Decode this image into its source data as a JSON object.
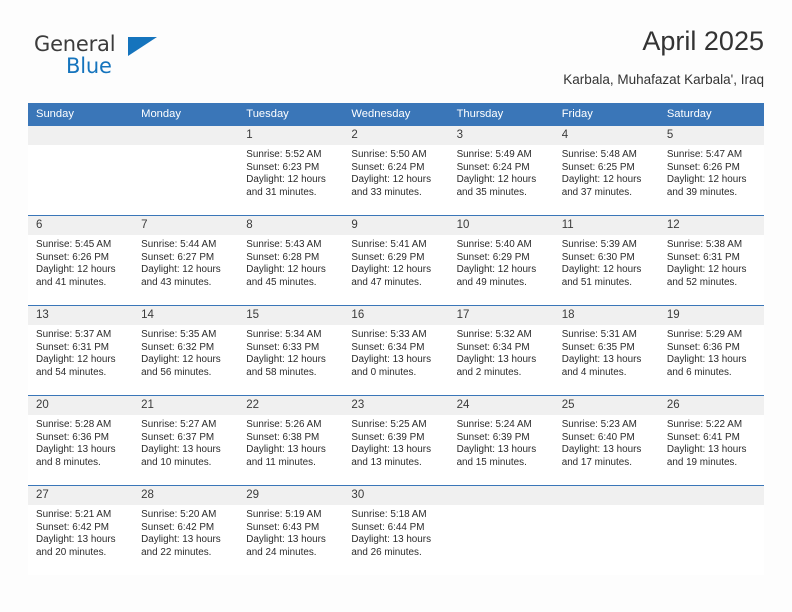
{
  "brand": {
    "name_line1": "General",
    "name_line2": "Blue",
    "color_dark": "#3c3c3c",
    "color_blue": "#1574bd"
  },
  "header": {
    "title": "April 2025",
    "subtitle": "Karbala, Muhafazat Karbala', Iraq"
  },
  "theme": {
    "header_blue": "#3a76b8",
    "daynum_bg": "#f0f0f0",
    "text": "#2b2b2b",
    "page_bg": "#fdfdfd"
  },
  "weekdays": [
    "Sunday",
    "Monday",
    "Tuesday",
    "Wednesday",
    "Thursday",
    "Friday",
    "Saturday"
  ],
  "labels": {
    "sunrise_prefix": "Sunrise:",
    "sunset_prefix": "Sunset:",
    "daylight_prefix": "Daylight:"
  },
  "weeks": [
    [
      {
        "day": "",
        "empty": true
      },
      {
        "day": "",
        "empty": true
      },
      {
        "day": "1",
        "sunrise": "Sunrise: 5:52 AM",
        "sunset": "Sunset: 6:23 PM",
        "daylight_l1": "Daylight: 12 hours",
        "daylight_l2": "and 31 minutes."
      },
      {
        "day": "2",
        "sunrise": "Sunrise: 5:50 AM",
        "sunset": "Sunset: 6:24 PM",
        "daylight_l1": "Daylight: 12 hours",
        "daylight_l2": "and 33 minutes."
      },
      {
        "day": "3",
        "sunrise": "Sunrise: 5:49 AM",
        "sunset": "Sunset: 6:24 PM",
        "daylight_l1": "Daylight: 12 hours",
        "daylight_l2": "and 35 minutes."
      },
      {
        "day": "4",
        "sunrise": "Sunrise: 5:48 AM",
        "sunset": "Sunset: 6:25 PM",
        "daylight_l1": "Daylight: 12 hours",
        "daylight_l2": "and 37 minutes."
      },
      {
        "day": "5",
        "sunrise": "Sunrise: 5:47 AM",
        "sunset": "Sunset: 6:26 PM",
        "daylight_l1": "Daylight: 12 hours",
        "daylight_l2": "and 39 minutes."
      }
    ],
    [
      {
        "day": "6",
        "sunrise": "Sunrise: 5:45 AM",
        "sunset": "Sunset: 6:26 PM",
        "daylight_l1": "Daylight: 12 hours",
        "daylight_l2": "and 41 minutes."
      },
      {
        "day": "7",
        "sunrise": "Sunrise: 5:44 AM",
        "sunset": "Sunset: 6:27 PM",
        "daylight_l1": "Daylight: 12 hours",
        "daylight_l2": "and 43 minutes."
      },
      {
        "day": "8",
        "sunrise": "Sunrise: 5:43 AM",
        "sunset": "Sunset: 6:28 PM",
        "daylight_l1": "Daylight: 12 hours",
        "daylight_l2": "and 45 minutes."
      },
      {
        "day": "9",
        "sunrise": "Sunrise: 5:41 AM",
        "sunset": "Sunset: 6:29 PM",
        "daylight_l1": "Daylight: 12 hours",
        "daylight_l2": "and 47 minutes."
      },
      {
        "day": "10",
        "sunrise": "Sunrise: 5:40 AM",
        "sunset": "Sunset: 6:29 PM",
        "daylight_l1": "Daylight: 12 hours",
        "daylight_l2": "and 49 minutes."
      },
      {
        "day": "11",
        "sunrise": "Sunrise: 5:39 AM",
        "sunset": "Sunset: 6:30 PM",
        "daylight_l1": "Daylight: 12 hours",
        "daylight_l2": "and 51 minutes."
      },
      {
        "day": "12",
        "sunrise": "Sunrise: 5:38 AM",
        "sunset": "Sunset: 6:31 PM",
        "daylight_l1": "Daylight: 12 hours",
        "daylight_l2": "and 52 minutes."
      }
    ],
    [
      {
        "day": "13",
        "sunrise": "Sunrise: 5:37 AM",
        "sunset": "Sunset: 6:31 PM",
        "daylight_l1": "Daylight: 12 hours",
        "daylight_l2": "and 54 minutes."
      },
      {
        "day": "14",
        "sunrise": "Sunrise: 5:35 AM",
        "sunset": "Sunset: 6:32 PM",
        "daylight_l1": "Daylight: 12 hours",
        "daylight_l2": "and 56 minutes."
      },
      {
        "day": "15",
        "sunrise": "Sunrise: 5:34 AM",
        "sunset": "Sunset: 6:33 PM",
        "daylight_l1": "Daylight: 12 hours",
        "daylight_l2": "and 58 minutes."
      },
      {
        "day": "16",
        "sunrise": "Sunrise: 5:33 AM",
        "sunset": "Sunset: 6:34 PM",
        "daylight_l1": "Daylight: 13 hours",
        "daylight_l2": "and 0 minutes."
      },
      {
        "day": "17",
        "sunrise": "Sunrise: 5:32 AM",
        "sunset": "Sunset: 6:34 PM",
        "daylight_l1": "Daylight: 13 hours",
        "daylight_l2": "and 2 minutes."
      },
      {
        "day": "18",
        "sunrise": "Sunrise: 5:31 AM",
        "sunset": "Sunset: 6:35 PM",
        "daylight_l1": "Daylight: 13 hours",
        "daylight_l2": "and 4 minutes."
      },
      {
        "day": "19",
        "sunrise": "Sunrise: 5:29 AM",
        "sunset": "Sunset: 6:36 PM",
        "daylight_l1": "Daylight: 13 hours",
        "daylight_l2": "and 6 minutes."
      }
    ],
    [
      {
        "day": "20",
        "sunrise": "Sunrise: 5:28 AM",
        "sunset": "Sunset: 6:36 PM",
        "daylight_l1": "Daylight: 13 hours",
        "daylight_l2": "and 8 minutes."
      },
      {
        "day": "21",
        "sunrise": "Sunrise: 5:27 AM",
        "sunset": "Sunset: 6:37 PM",
        "daylight_l1": "Daylight: 13 hours",
        "daylight_l2": "and 10 minutes."
      },
      {
        "day": "22",
        "sunrise": "Sunrise: 5:26 AM",
        "sunset": "Sunset: 6:38 PM",
        "daylight_l1": "Daylight: 13 hours",
        "daylight_l2": "and 11 minutes."
      },
      {
        "day": "23",
        "sunrise": "Sunrise: 5:25 AM",
        "sunset": "Sunset: 6:39 PM",
        "daylight_l1": "Daylight: 13 hours",
        "daylight_l2": "and 13 minutes."
      },
      {
        "day": "24",
        "sunrise": "Sunrise: 5:24 AM",
        "sunset": "Sunset: 6:39 PM",
        "daylight_l1": "Daylight: 13 hours",
        "daylight_l2": "and 15 minutes."
      },
      {
        "day": "25",
        "sunrise": "Sunrise: 5:23 AM",
        "sunset": "Sunset: 6:40 PM",
        "daylight_l1": "Daylight: 13 hours",
        "daylight_l2": "and 17 minutes."
      },
      {
        "day": "26",
        "sunrise": "Sunrise: 5:22 AM",
        "sunset": "Sunset: 6:41 PM",
        "daylight_l1": "Daylight: 13 hours",
        "daylight_l2": "and 19 minutes."
      }
    ],
    [
      {
        "day": "27",
        "sunrise": "Sunrise: 5:21 AM",
        "sunset": "Sunset: 6:42 PM",
        "daylight_l1": "Daylight: 13 hours",
        "daylight_l2": "and 20 minutes."
      },
      {
        "day": "28",
        "sunrise": "Sunrise: 5:20 AM",
        "sunset": "Sunset: 6:42 PM",
        "daylight_l1": "Daylight: 13 hours",
        "daylight_l2": "and 22 minutes."
      },
      {
        "day": "29",
        "sunrise": "Sunrise: 5:19 AM",
        "sunset": "Sunset: 6:43 PM",
        "daylight_l1": "Daylight: 13 hours",
        "daylight_l2": "and 24 minutes."
      },
      {
        "day": "30",
        "sunrise": "Sunrise: 5:18 AM",
        "sunset": "Sunset: 6:44 PM",
        "daylight_l1": "Daylight: 13 hours",
        "daylight_l2": "and 26 minutes."
      },
      {
        "day": "",
        "empty": true
      },
      {
        "day": "",
        "empty": true
      },
      {
        "day": "",
        "empty": true
      }
    ]
  ]
}
